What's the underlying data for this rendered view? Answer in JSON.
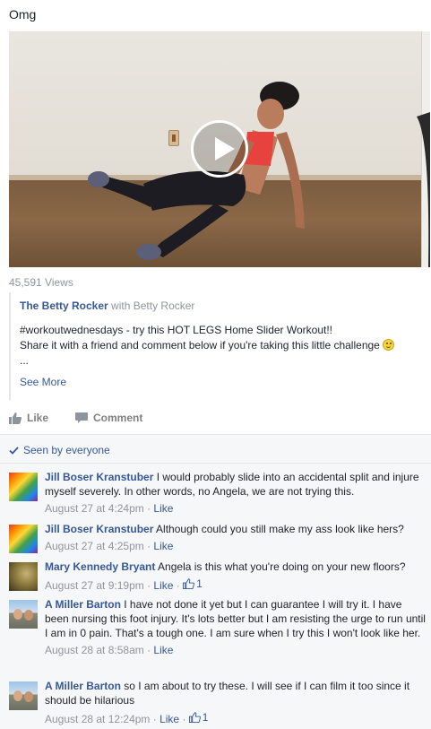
{
  "post": {
    "text": "Omg"
  },
  "video": {
    "views": "45,591 Views"
  },
  "share": {
    "page_name": "The Betty Rocker",
    "with_text": "with",
    "with_name": "Betty Rocker",
    "desc_line1": "#workoutwednesdays - try this HOT LEGS Home Slider Workout!!",
    "desc_line2": "Share it with a friend and comment below if you're taking this little challenge",
    "ellipsis": "...",
    "see_more": "See More"
  },
  "actions": {
    "like": "Like",
    "comment": "Comment"
  },
  "seen": {
    "label": "Seen by everyone"
  },
  "comments": [
    {
      "author": "Jill Boser Kranstuber",
      "text": "I would probably slide into an accidental split and injure myself severely. In other words, no Angela, we are not trying this.",
      "time": "August 27 at 4:24pm",
      "like_label": "Like",
      "like_count": ""
    },
    {
      "author": "Jill Boser Kranstuber",
      "text": "Although could you still make my ass look like hers?",
      "time": "August 27 at 4:25pm",
      "like_label": "Like",
      "like_count": ""
    },
    {
      "author": "Mary Kennedy Bryant",
      "text": "Angela is this what you're doing on your new floors?",
      "time": "August 27 at 9:19pm",
      "like_label": "Like",
      "like_count": "1"
    },
    {
      "author": "A Miller Barton",
      "text": "I have not done it yet but I can guarantee I will try it. I have been nursing this foot injury. It's lots better but I am resisting the urge to run until I am in 0 pain. That's a tough one. I am sure when I try this I won't look like her.",
      "time": "August 28 at 8:58am",
      "like_label": "Like",
      "like_count": ""
    },
    {
      "author": "A Miller Barton",
      "text": "so I am about to try these. I will see if I can film it too since it should be hilarious",
      "time": "August 28 at 12:24pm",
      "like_label": "Like",
      "like_count": "1"
    }
  ],
  "colors": {
    "link": "#365899",
    "muted": "#90949c",
    "comments_bg": "#f6f7f9"
  },
  "icons": {
    "like": "thumbs-up-icon",
    "comment": "speech-bubble-icon",
    "seen": "checkmark-icon",
    "play": "play-icon"
  }
}
